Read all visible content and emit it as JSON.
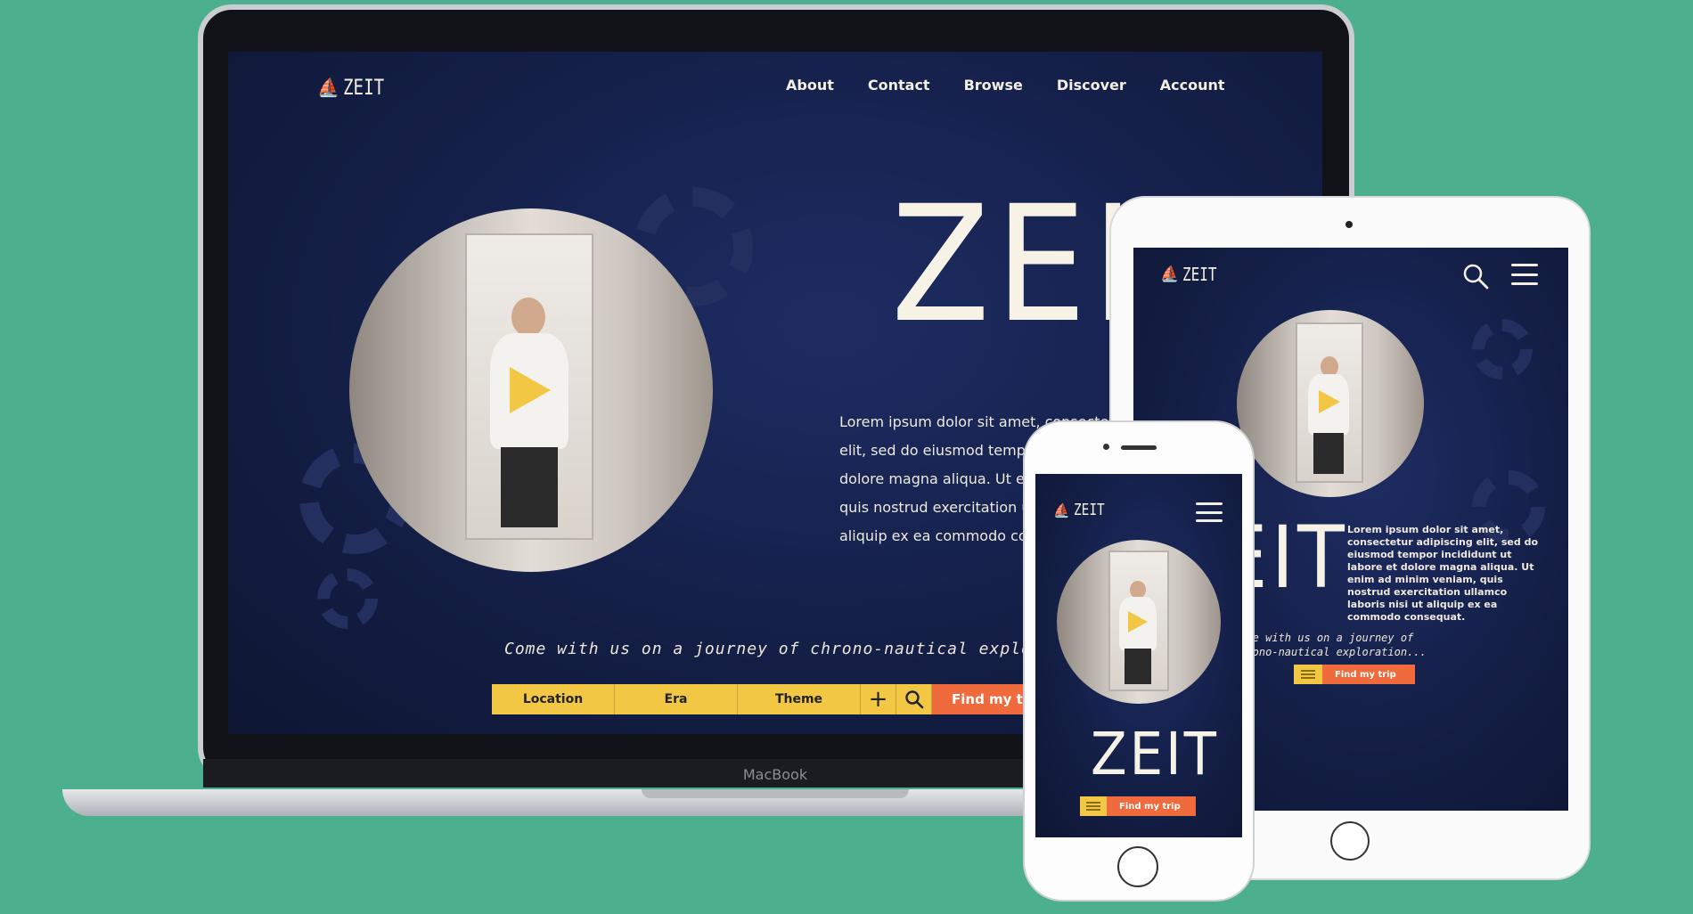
{
  "brand": {
    "logo_text": "ZEIT",
    "hero_title": "ZEIT"
  },
  "laptop": {
    "nav": [
      "About",
      "Contact",
      "Browse",
      "Discover",
      "Account"
    ],
    "lorem_lines": [
      "Lorem ipsum dolor sit amet, consectetur",
      "elit, sed do eiusmod tempo",
      "dolore magna aliqua. Ut en",
      "quis nostrud exercitation ul",
      "aliquip ex ea commodo con"
    ],
    "tagline": "Come with us on a journey of chrono-nautical exploration",
    "search": {
      "location": "Location",
      "era": "Era",
      "theme": "Theme",
      "plus": "+",
      "find": "Find my t"
    },
    "device_label": "MacBook"
  },
  "tablet": {
    "hero_partial": "EIT",
    "lorem": "Lorem ipsum dolor sit amet, consectetur adipiscing elit, sed do eiusmod tempor incididunt ut labore et dolore magna aliqua. Ut enim ad minim veniam, quis nostrud exercitation ullamco laboris nisi ut aliquip ex ea commodo consequat.",
    "tagline": "Come with us on a journey of chrono-nautical exploration...",
    "find": "Find my trip"
  },
  "phone": {
    "find": "Find my trip"
  },
  "icons": {
    "logo": "ship-icon",
    "play": "play-icon",
    "search": "search-icon",
    "menu": "hamburger-menu-icon",
    "filter": "filter-lines-icon",
    "plus": "plus-icon"
  },
  "colors": {
    "background": "#4caf8e",
    "site_bg": "#141f47",
    "accent_yellow": "#f2c744",
    "accent_orange": "#ef6a3c",
    "text_cream": "#f6f2e6"
  }
}
